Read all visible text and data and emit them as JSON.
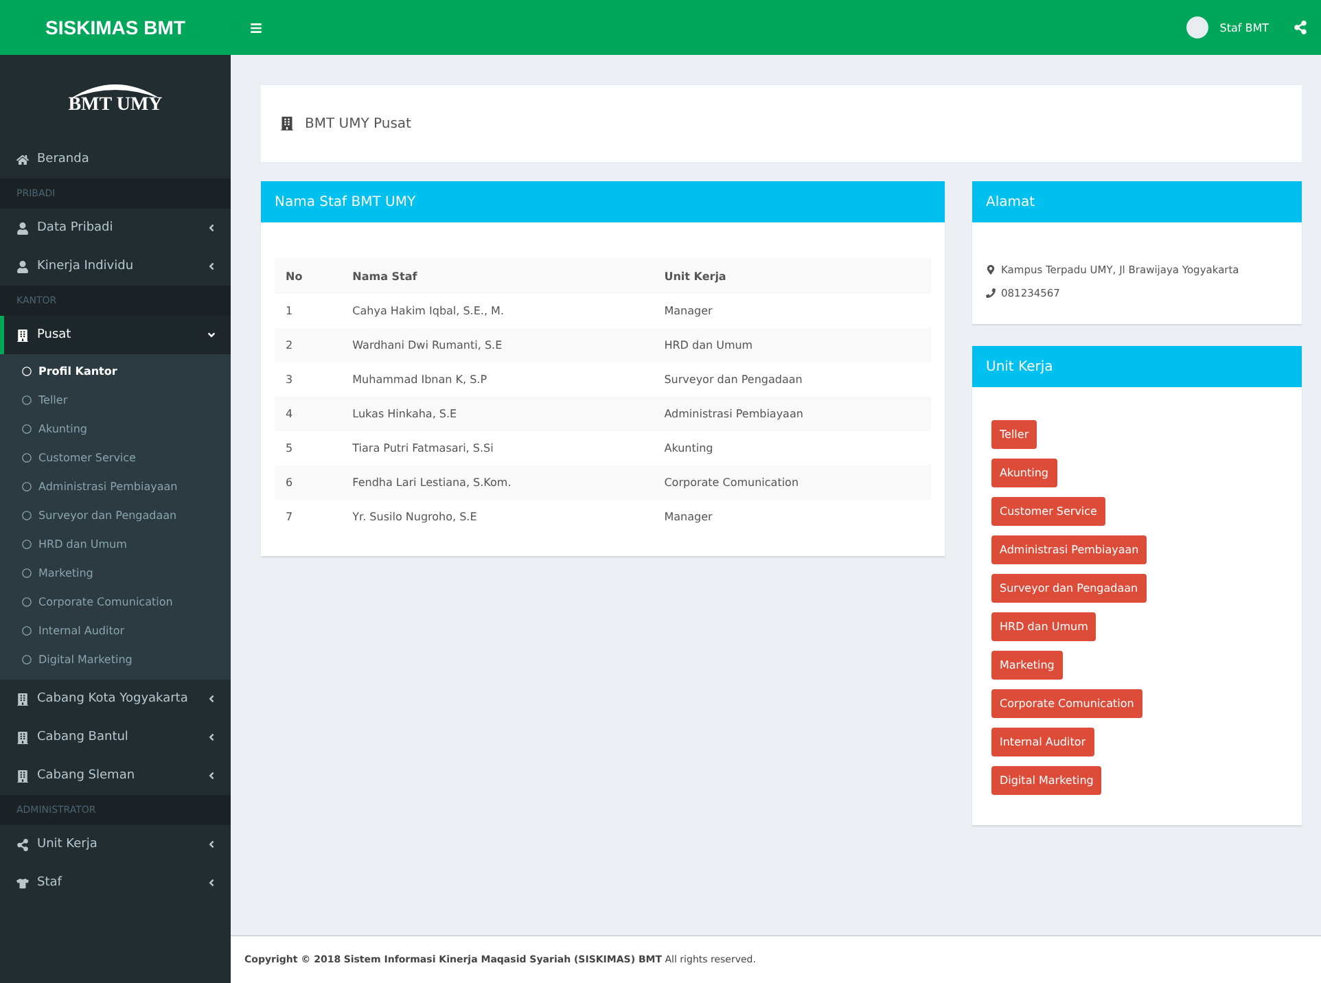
{
  "brand": "SISKIMAS BMT",
  "logo": {
    "text": "BMT UMY"
  },
  "topbar": {
    "user": "Staf BMT"
  },
  "sidebar": [
    {
      "kind": "item",
      "label": "Beranda",
      "selected": false
    },
    {
      "kind": "header",
      "label": "PRIBADI"
    },
    {
      "kind": "item",
      "label": "Data Pribadi",
      "selected": false,
      "expanded": false
    },
    {
      "kind": "item",
      "label": "Kinerja Individu",
      "selected": false,
      "expanded": false
    },
    {
      "kind": "header",
      "label": "KANTOR"
    },
    {
      "kind": "item",
      "label": "Pusat",
      "selected": true,
      "expanded": true,
      "children": [
        {
          "label": "Profil Kantor",
          "selected": true
        },
        {
          "label": "Teller",
          "selected": false
        },
        {
          "label": "Akunting",
          "selected": false
        },
        {
          "label": "Customer Service",
          "selected": false
        },
        {
          "label": "Administrasi Pembiayaan",
          "selected": false
        },
        {
          "label": "Surveyor dan Pengadaan",
          "selected": false
        },
        {
          "label": "HRD dan Umum",
          "selected": false
        },
        {
          "label": "Marketing",
          "selected": false
        },
        {
          "label": "Corporate Comunication",
          "selected": false
        },
        {
          "label": "Internal Auditor",
          "selected": false
        },
        {
          "label": "Digital Marketing",
          "selected": false
        }
      ]
    },
    {
      "kind": "item",
      "label": "Cabang Kota Yogyakarta",
      "selected": false,
      "expanded": false
    },
    {
      "kind": "item",
      "label": "Cabang Bantul",
      "selected": false,
      "expanded": false
    },
    {
      "kind": "item",
      "label": "Cabang Sleman",
      "selected": false,
      "expanded": false
    },
    {
      "kind": "header",
      "label": "ADMINISTRATOR"
    },
    {
      "kind": "item",
      "label": "Unit Kerja",
      "selected": false,
      "expanded": false
    },
    {
      "kind": "item",
      "label": "Staf",
      "selected": false,
      "expanded": false
    }
  ],
  "breadcrumb": "BMT UMY Pusat",
  "staff_card": {
    "title": "Nama Staf BMT UMY",
    "columns": [
      "No",
      "Nama Staf",
      "Unit Kerja"
    ],
    "rows": [
      [
        "1",
        "Cahya Hakim Iqbal, S.E., M.",
        "Manager"
      ],
      [
        "2",
        "Wardhani Dwi Rumanti, S.E",
        "HRD dan Umum"
      ],
      [
        "3",
        "Muhammad Ibnan K, S.P",
        "Surveyor dan Pengadaan"
      ],
      [
        "4",
        "Lukas Hinkaha, S.E",
        "Administrasi Pembiayaan"
      ],
      [
        "5",
        "Tiara Putri Fatmasari, S.Si",
        "Akunting"
      ],
      [
        "6",
        "Fendha Lari Lestiana, S.Kom.",
        "Corporate Comunication"
      ],
      [
        "7",
        "Yr. Susilo Nugroho, S.E",
        "Manager"
      ]
    ]
  },
  "address_card": {
    "title": "Alamat",
    "address": "Kampus Terpadu UMY, Jl Brawijaya Yogyakarta",
    "phone": "081234567"
  },
  "units_card": {
    "title": "Unit Kerja",
    "units": [
      "Teller",
      "Akunting",
      "Customer Service",
      "Administrasi Pembiayaan",
      "Surveyor dan Pengadaan",
      "HRD dan Umum",
      "Marketing",
      "Corporate Comunication",
      "Internal Auditor",
      "Digital Marketing"
    ]
  },
  "footer": "**Copyright © 2018** **Sistem Informasi Kinerja Maqasid Syariah (SISKIMAS) BMT** All rights reserved."
}
